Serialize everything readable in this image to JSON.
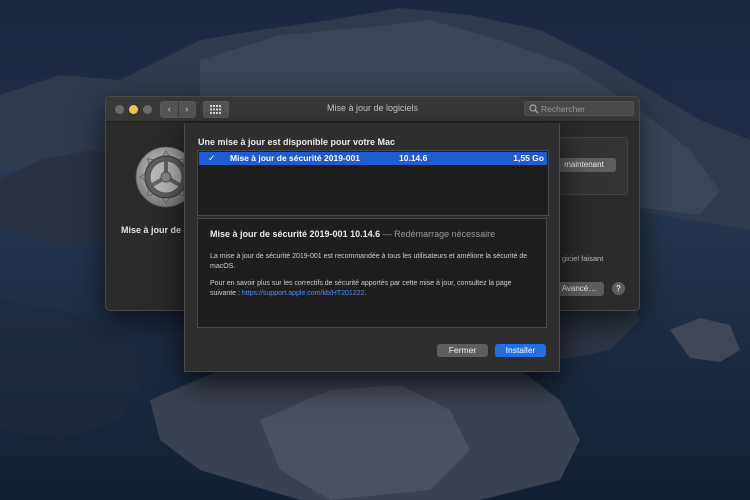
{
  "window": {
    "title": "Mise à jour de logiciels",
    "nav_back": "‹",
    "nav_forward": "›",
    "search_placeholder": "Rechercher",
    "side_label": "Mise à jour de",
    "update_now_button": "maintenant",
    "right_text": "giciel faisant",
    "advanced_button": "Avancé…",
    "help_button": "?"
  },
  "sheet": {
    "heading": "Une mise à jour est disponible pour votre Mac",
    "updates": [
      {
        "checked": "✓",
        "name": "Mise à jour de sécurité 2019-001",
        "version": "10.14.6",
        "size": "1,55 Go"
      }
    ],
    "detail": {
      "title": "Mise à jour de sécurité 2019-001 10.14.6",
      "subtitle": "— Redémarrage nécessaire",
      "paragraph1": "La mise à jour de sécurité 2019-001 est recommandée à tous les utilisateurs et améliore la sécurité de macOS.",
      "paragraph2": "Pour en savoir plus sur les correctifs de sécurité apportés par cette mise à jour, consultez la page suivante :",
      "link": "https://support.apple.com/kb/HT201222",
      "link_suffix": "."
    },
    "close_button": "Fermer",
    "install_button": "Installer"
  },
  "colors": {
    "accent": "#1f6fe5",
    "selection": "#1f5bd1",
    "link": "#4a8dff",
    "minimize_light": "#f5bf4f"
  }
}
